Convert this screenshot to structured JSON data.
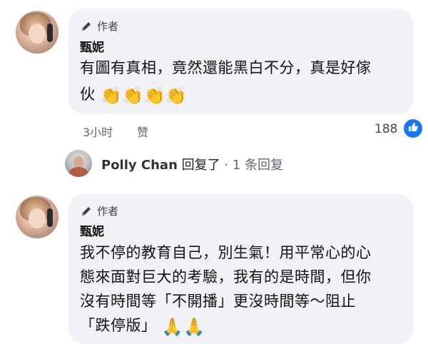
{
  "comments": [
    {
      "author_badge": "作者",
      "name": "甄妮",
      "lines": [
        "有圖有真相，竟然還能黑白不分，真是好傢",
        "伙"
      ],
      "emoji": [
        "👏",
        "👏",
        "👏",
        "👏"
      ],
      "time": "3小时",
      "like_label": "赞",
      "like_count": "188"
    },
    {
      "author_badge": "作者",
      "name": "甄妮",
      "lines": [
        "我不停的教育自己，別生氣！用平常心的心",
        "態來面對巨大的考驗，我有的是時間，但你",
        "沒有時間等「不開播」更沒時間等～阻止",
        "「跌停版」"
      ],
      "emoji": [
        "🙏",
        "🙏"
      ]
    }
  ],
  "reply_summary": {
    "name": "Polly Chan",
    "action": "回复了",
    "count": "· 1 条回复"
  }
}
